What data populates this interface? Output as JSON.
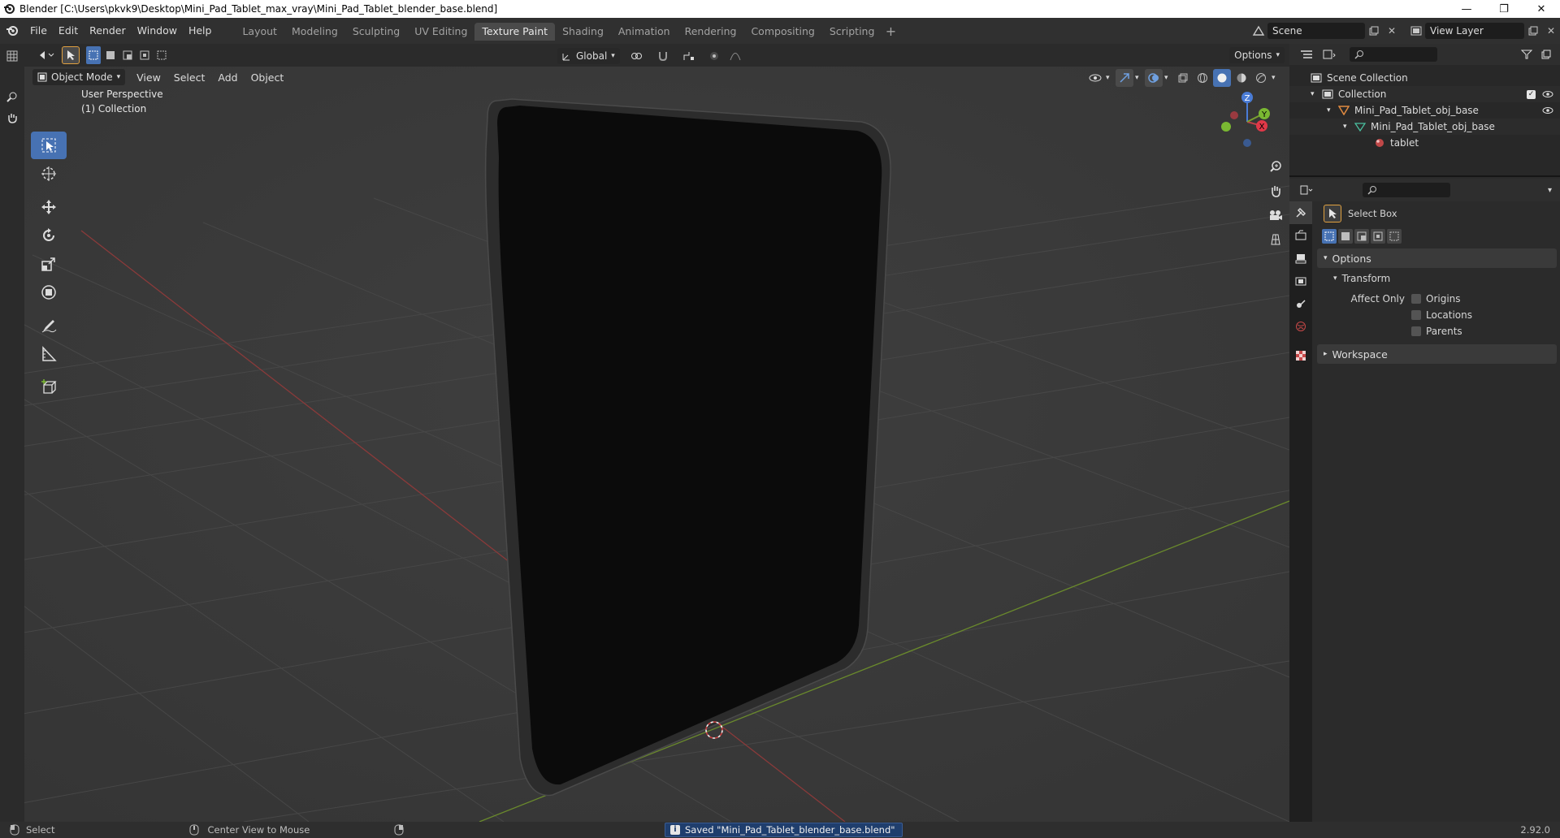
{
  "window": {
    "title": "Blender [C:\\Users\\pkvk9\\Desktop\\Mini_Pad_Tablet_max_vray\\Mini_Pad_Tablet_blender_base.blend]",
    "minimize": "—",
    "maximize": "❐",
    "close": "✕"
  },
  "menu": [
    "File",
    "Edit",
    "Render",
    "Window",
    "Help"
  ],
  "workspaces": [
    {
      "label": "Layout",
      "active": false
    },
    {
      "label": "Modeling",
      "active": false
    },
    {
      "label": "Sculpting",
      "active": false
    },
    {
      "label": "UV Editing",
      "active": false
    },
    {
      "label": "Texture Paint",
      "active": true
    },
    {
      "label": "Shading",
      "active": false
    },
    {
      "label": "Animation",
      "active": false
    },
    {
      "label": "Rendering",
      "active": false
    },
    {
      "label": "Compositing",
      "active": false
    },
    {
      "label": "Scripting",
      "active": false
    }
  ],
  "topright": {
    "scene": "Scene",
    "view_layer": "View Layer"
  },
  "viewport": {
    "mode": "Object Mode",
    "menus": [
      "View",
      "Select",
      "Add",
      "Object"
    ],
    "transform_orientation": "Global",
    "options": "Options",
    "overlay_line1": "User Perspective",
    "overlay_line2": "(1) Collection",
    "gizmo": {
      "x": "X",
      "y": "Y",
      "z": "Z"
    },
    "accent": "#4772b3"
  },
  "outliner": {
    "rows": [
      {
        "label": "Scene Collection",
        "indent": 0,
        "icon": "scene-collection-icon"
      },
      {
        "label": "Collection",
        "indent": 1,
        "icon": "collection-icon"
      },
      {
        "label": "Mini_Pad_Tablet_obj_base",
        "indent": 2,
        "icon": "object-icon"
      },
      {
        "label": "Mini_Pad_Tablet_obj_base",
        "indent": 3,
        "icon": "mesh-icon"
      },
      {
        "label": "tablet",
        "indent": 4,
        "icon": "material-icon"
      }
    ]
  },
  "properties": {
    "tool_name": "Select Box",
    "options_label": "Options",
    "transform_label": "Transform",
    "affect_only": "Affect Only",
    "checks": [
      "Origins",
      "Locations",
      "Parents"
    ],
    "workspace_label": "Workspace"
  },
  "status": {
    "select": "Select",
    "center_view": "Center View to Mouse",
    "message": "Saved \"Mini_Pad_Tablet_blender_base.blend\"",
    "version": "2.92.0"
  }
}
